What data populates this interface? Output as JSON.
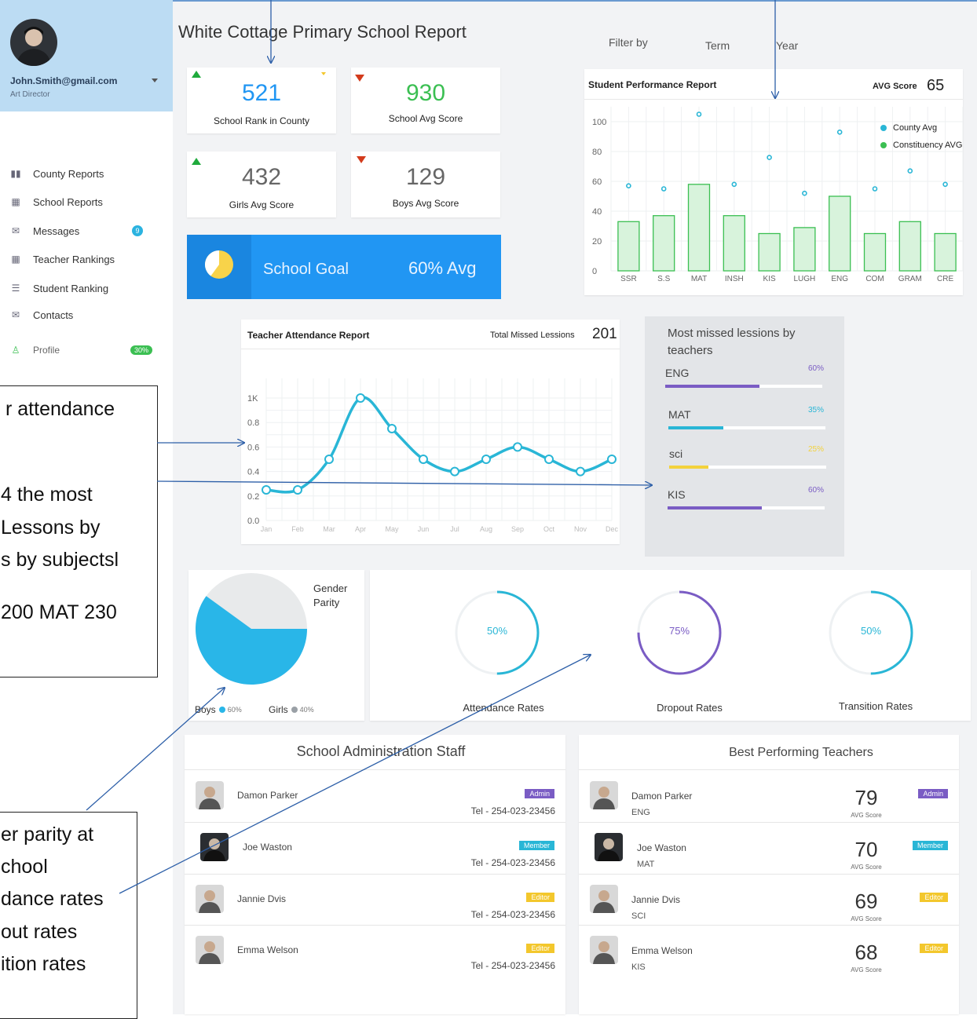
{
  "user": {
    "email": "John.Smith@gmail.com",
    "role": "Art Director"
  },
  "nav": {
    "items": [
      {
        "label": "County Reports",
        "icon": "bar-chart-icon"
      },
      {
        "label": "School Reports",
        "icon": "calendar-icon"
      },
      {
        "label": "Messages",
        "icon": "envelope-icon",
        "badge": "9"
      },
      {
        "label": "Teacher Rankings",
        "icon": "grid-icon"
      },
      {
        "label": "Student Ranking",
        "icon": "list-icon"
      },
      {
        "label": "Contacts",
        "icon": "envelope-icon"
      },
      {
        "label": "Profile",
        "icon": "user-icon",
        "badge": "30%"
      }
    ]
  },
  "header": {
    "title": "White Cottage Primary School Report",
    "filter_label": "Filter by",
    "term_label": "Term",
    "year_label": "Year"
  },
  "kpis": [
    {
      "value": "521",
      "label": "School Rank in County",
      "trend": "up",
      "color": "#2196f3"
    },
    {
      "value": "930",
      "label": "School Avg Score",
      "trend": "down",
      "color": "#3bbf52"
    },
    {
      "value": "432",
      "label": "Girls Avg Score",
      "trend": "up",
      "color": "#666666"
    },
    {
      "value": "129",
      "label": "Boys Avg Score",
      "trend": "down",
      "color": "#666666"
    }
  ],
  "goal": {
    "label": "School Goal",
    "value": "60% Avg",
    "fraction": 0.6
  },
  "student_perf": {
    "title": "Student Performance Report",
    "avg_label": "AVG Score",
    "avg_value": "65",
    "legend": [
      {
        "name": "County Avg",
        "color": "#29b6d6"
      },
      {
        "name": "Constituency AVG",
        "color": "#3bbf52"
      }
    ]
  },
  "teacher_attendance": {
    "title": "Teacher Attendance Report",
    "missed_label": "Total Missed Lessions",
    "missed_value": "201"
  },
  "missed_lessons": {
    "title": "Most missed lessions by teachers",
    "items": [
      {
        "subject": "ENG",
        "percent": "60%",
        "fraction": 0.6,
        "color": "#7a5cc4"
      },
      {
        "subject": "MAT",
        "percent": "35%",
        "fraction": 0.35,
        "color": "#29b6d6"
      },
      {
        "subject": "sci",
        "percent": "25%",
        "fraction": 0.25,
        "color": "#f3d23c"
      },
      {
        "subject": "KIS",
        "percent": "60%",
        "fraction": 0.6,
        "color": "#7a5cc4"
      }
    ]
  },
  "gender": {
    "title": "Gender Parity",
    "boys_label": "Boys",
    "boys_pct": "60%",
    "girls_label": "Girls",
    "girls_pct": "40%",
    "boys_fraction": 0.6
  },
  "rates": [
    {
      "value": "50%",
      "label": "Attendance Rates",
      "fraction": 0.5,
      "color": "#29b6d6"
    },
    {
      "value": "75%",
      "label": "Dropout Rates",
      "fraction": 0.75,
      "color": "#7a5cc4"
    },
    {
      "value": "50%",
      "label": "Transition Rates",
      "fraction": 0.5,
      "color": "#29b6d6"
    }
  ],
  "admin_staff": {
    "title": "School Administration Staff",
    "people": [
      {
        "name": "Damon Parker",
        "tag": "Admin",
        "tag_color": "#7a5cc4",
        "tel": "Tel - 254-023-23456"
      },
      {
        "name": "Joe Waston",
        "tag": "Member",
        "tag_color": "#29b6d6",
        "tel": "Tel - 254-023-23456"
      },
      {
        "name": "Jannie Dvis",
        "tag": "Editor",
        "tag_color": "#f3c72c",
        "tel": "Tel - 254-023-23456"
      },
      {
        "name": "Emma Welson",
        "tag": "Editor",
        "tag_color": "#f3c72c",
        "tel": "Tel - 254-023-23456"
      }
    ]
  },
  "best_teachers": {
    "title": "Best Performing Teachers",
    "score_label": "AVG Score",
    "people": [
      {
        "name": "Damon Parker",
        "subject": "ENG",
        "score": "79",
        "tag": "Admin",
        "tag_color": "#7a5cc4"
      },
      {
        "name": "Joe Waston",
        "subject": "MAT",
        "score": "70",
        "tag": "Member",
        "tag_color": "#29b6d6"
      },
      {
        "name": "Jannie Dvis",
        "subject": "SCI",
        "score": "69",
        "tag": "Editor",
        "tag_color": "#f3c72c"
      },
      {
        "name": "Emma Welson",
        "subject": "KIS",
        "score": "68",
        "tag": "Editor",
        "tag_color": "#f3c72c"
      }
    ]
  },
  "callouts": {
    "box1": [
      "r attendance",
      "4  the most",
      "Lessons by",
      "s by subjectsl",
      "200 MAT 230"
    ],
    "box2": [
      "er parity at",
      "chool",
      "dance rates",
      "out rates",
      "ition rates"
    ]
  },
  "chart_data": [
    {
      "type": "bar",
      "title": "Student Performance Report",
      "categories": [
        "SSR",
        "S.S",
        "MAT",
        "INSH",
        "KIS",
        "LUGH",
        "ENG",
        "COM",
        "GRAM",
        "CRE"
      ],
      "series": [
        {
          "name": "Constituency AVG",
          "type": "bar",
          "values": [
            33,
            37,
            58,
            37,
            25,
            29,
            50,
            25,
            33,
            25
          ]
        },
        {
          "name": "County Avg",
          "type": "scatter",
          "values": [
            57,
            55,
            105,
            58,
            76,
            52,
            93,
            55,
            67,
            58
          ]
        }
      ],
      "yticks": [
        0,
        20,
        40,
        60,
        80,
        100
      ],
      "ylim": [
        0,
        110
      ]
    },
    {
      "type": "line",
      "title": "Teacher Attendance Report",
      "categories": [
        "Jan",
        "Feb",
        "Mar",
        "Apr",
        "May",
        "Jun",
        "Jul",
        "Aug",
        "Sep",
        "Oct",
        "Nov",
        "Dec"
      ],
      "series": [
        {
          "values": [
            0.25,
            0.25,
            0.5,
            1.0,
            0.75,
            0.5,
            0.4,
            0.5,
            0.6,
            0.5,
            0.4,
            0.5
          ]
        }
      ],
      "ytick_labels": [
        "0.0",
        "0.2",
        "0.4",
        "0.6",
        "0.8",
        "1K"
      ],
      "yticks": [
        0,
        0.2,
        0.4,
        0.6,
        0.8,
        1.0
      ],
      "ylim": [
        0,
        1.0
      ]
    },
    {
      "type": "pie",
      "title": "Gender Parity",
      "categories": [
        "Boys",
        "Girls"
      ],
      "values": [
        60,
        40
      ]
    }
  ]
}
